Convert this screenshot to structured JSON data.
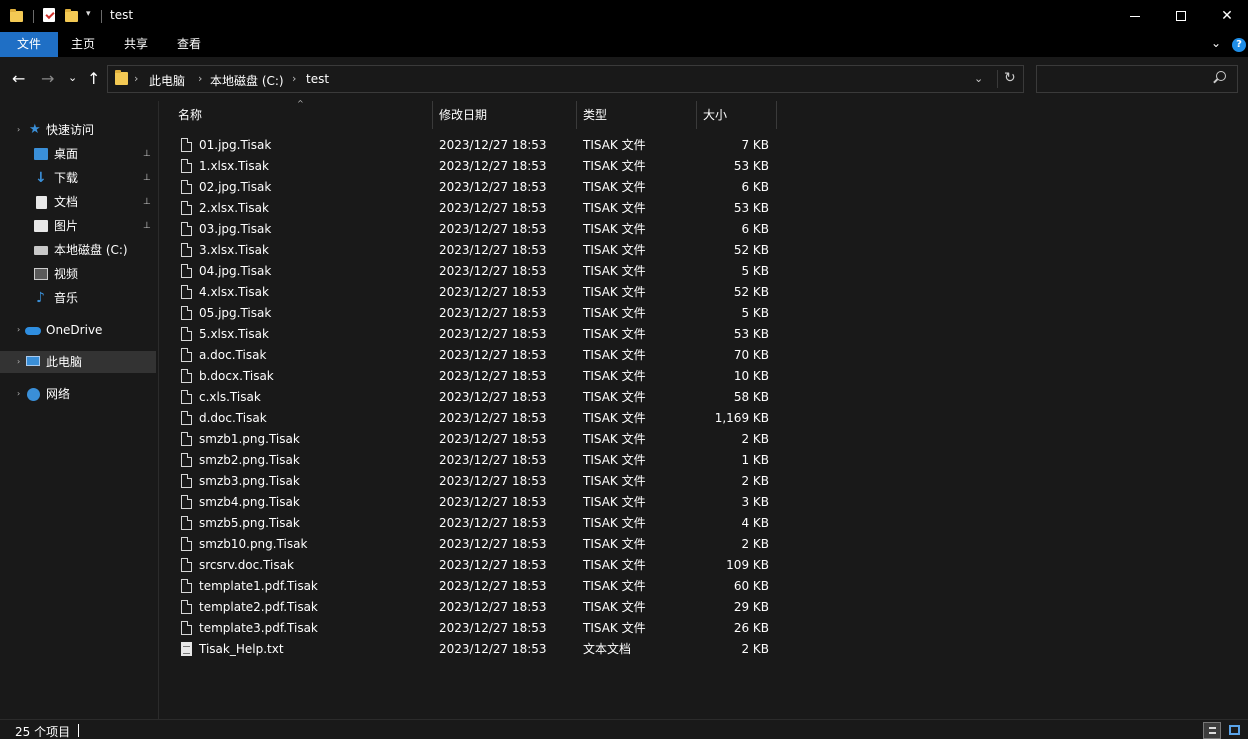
{
  "window": {
    "title": "test",
    "minimize_icon": "minimize-icon",
    "maximize_icon": "maximize-icon",
    "close_glyph": "✕"
  },
  "ribbon": {
    "tabs": [
      "文件",
      "主页",
      "共享",
      "查看"
    ],
    "expand_glyph": "⌄",
    "help_glyph": "?"
  },
  "nav": {
    "back_glyph": "←",
    "forward_glyph": "→",
    "recent_glyph": "⌄",
    "up_glyph": "↑",
    "breadcrumbs": [
      "此电脑",
      "本地磁盘 (C:)",
      "test"
    ],
    "crumb_separator": "›",
    "dropdown_glyph": "⌄",
    "refresh_glyph": "↻",
    "search_placeholder": ""
  },
  "sidebar": {
    "items": [
      {
        "label": "快速访问",
        "icon": "star-icon",
        "pinned": false
      },
      {
        "label": "桌面",
        "icon": "desktop-icon",
        "pinned": true
      },
      {
        "label": "下载",
        "icon": "download-icon",
        "pinned": true
      },
      {
        "label": "文档",
        "icon": "documents-icon",
        "pinned": true
      },
      {
        "label": "图片",
        "icon": "pictures-icon",
        "pinned": true
      },
      {
        "label": "本地磁盘 (C:)",
        "icon": "drive-icon",
        "pinned": false
      },
      {
        "label": "视频",
        "icon": "video-icon",
        "pinned": false
      },
      {
        "label": "音乐",
        "icon": "music-icon",
        "pinned": false
      },
      {
        "label": "OneDrive",
        "icon": "onedrive-icon",
        "pinned": false
      },
      {
        "label": "此电脑",
        "icon": "this-pc-icon",
        "pinned": false,
        "selected": true
      },
      {
        "label": "网络",
        "icon": "network-icon",
        "pinned": false
      }
    ],
    "pin_glyph": "📌",
    "chevron_glyph": "›"
  },
  "columns": {
    "name": "名称",
    "date": "修改日期",
    "type": "类型",
    "size": "大小",
    "sort_glyph": "^"
  },
  "files": [
    {
      "name": "01.jpg.Tisak",
      "date": "2023/12/27 18:53",
      "type": "TISAK 文件",
      "size": "7 KB"
    },
    {
      "name": "1.xlsx.Tisak",
      "date": "2023/12/27 18:53",
      "type": "TISAK 文件",
      "size": "53 KB"
    },
    {
      "name": "02.jpg.Tisak",
      "date": "2023/12/27 18:53",
      "type": "TISAK 文件",
      "size": "6 KB"
    },
    {
      "name": "2.xlsx.Tisak",
      "date": "2023/12/27 18:53",
      "type": "TISAK 文件",
      "size": "53 KB"
    },
    {
      "name": "03.jpg.Tisak",
      "date": "2023/12/27 18:53",
      "type": "TISAK 文件",
      "size": "6 KB"
    },
    {
      "name": "3.xlsx.Tisak",
      "date": "2023/12/27 18:53",
      "type": "TISAK 文件",
      "size": "52 KB"
    },
    {
      "name": "04.jpg.Tisak",
      "date": "2023/12/27 18:53",
      "type": "TISAK 文件",
      "size": "5 KB"
    },
    {
      "name": "4.xlsx.Tisak",
      "date": "2023/12/27 18:53",
      "type": "TISAK 文件",
      "size": "52 KB"
    },
    {
      "name": "05.jpg.Tisak",
      "date": "2023/12/27 18:53",
      "type": "TISAK 文件",
      "size": "5 KB"
    },
    {
      "name": "5.xlsx.Tisak",
      "date": "2023/12/27 18:53",
      "type": "TISAK 文件",
      "size": "53 KB"
    },
    {
      "name": "a.doc.Tisak",
      "date": "2023/12/27 18:53",
      "type": "TISAK 文件",
      "size": "70 KB"
    },
    {
      "name": "b.docx.Tisak",
      "date": "2023/12/27 18:53",
      "type": "TISAK 文件",
      "size": "10 KB"
    },
    {
      "name": "c.xls.Tisak",
      "date": "2023/12/27 18:53",
      "type": "TISAK 文件",
      "size": "58 KB"
    },
    {
      "name": "d.doc.Tisak",
      "date": "2023/12/27 18:53",
      "type": "TISAK 文件",
      "size": "1,169 KB"
    },
    {
      "name": "smzb1.png.Tisak",
      "date": "2023/12/27 18:53",
      "type": "TISAK 文件",
      "size": "2 KB"
    },
    {
      "name": "smzb2.png.Tisak",
      "date": "2023/12/27 18:53",
      "type": "TISAK 文件",
      "size": "1 KB"
    },
    {
      "name": "smzb3.png.Tisak",
      "date": "2023/12/27 18:53",
      "type": "TISAK 文件",
      "size": "2 KB"
    },
    {
      "name": "smzb4.png.Tisak",
      "date": "2023/12/27 18:53",
      "type": "TISAK 文件",
      "size": "3 KB"
    },
    {
      "name": "smzb5.png.Tisak",
      "date": "2023/12/27 18:53",
      "type": "TISAK 文件",
      "size": "4 KB"
    },
    {
      "name": "smzb10.png.Tisak",
      "date": "2023/12/27 18:53",
      "type": "TISAK 文件",
      "size": "2 KB"
    },
    {
      "name": "srcsrv.doc.Tisak",
      "date": "2023/12/27 18:53",
      "type": "TISAK 文件",
      "size": "109 KB"
    },
    {
      "name": "template1.pdf.Tisak",
      "date": "2023/12/27 18:53",
      "type": "TISAK 文件",
      "size": "60 KB"
    },
    {
      "name": "template2.pdf.Tisak",
      "date": "2023/12/27 18:53",
      "type": "TISAK 文件",
      "size": "29 KB"
    },
    {
      "name": "template3.pdf.Tisak",
      "date": "2023/12/27 18:53",
      "type": "TISAK 文件",
      "size": "26 KB"
    },
    {
      "name": "Tisak_Help.txt",
      "date": "2023/12/27 18:53",
      "type": "文本文档",
      "size": "2 KB",
      "icon": "text-file-icon"
    }
  ],
  "status": {
    "item_count": "25 个项目"
  },
  "colors": {
    "background": "#191919",
    "titlebar": "#000000",
    "accent": "#1f6fc5",
    "selected": "#333333"
  }
}
